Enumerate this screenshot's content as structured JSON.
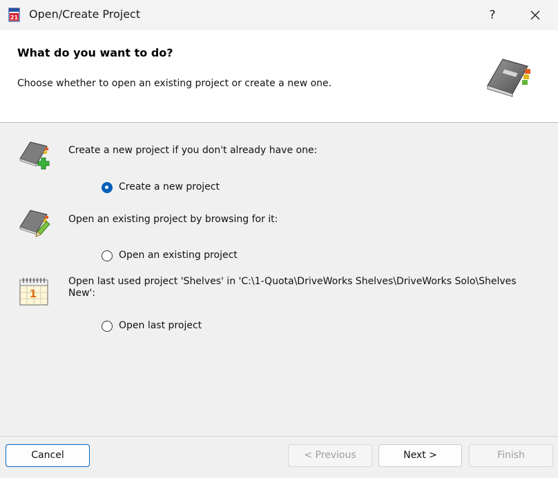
{
  "window": {
    "title": "Open/Create Project",
    "help_label": "?",
    "app_icon_text": "21"
  },
  "header": {
    "title": "What do you want to do?",
    "subtitle": "Choose whether to open an existing project or create a new one."
  },
  "options": [
    {
      "description": "Create a new project if you don't already have one:",
      "radio_label": "Create a new project",
      "selected": true,
      "icon": "book-add-icon"
    },
    {
      "description": "Open an existing project by browsing for it:",
      "radio_label": "Open an existing project",
      "selected": false,
      "icon": "book-edit-icon"
    },
    {
      "description": "Open last used project 'Shelves' in 'C:\\1-Quota\\DriveWorks Shelves\\DriveWorks Solo\\Shelves New':",
      "radio_label": "Open last project",
      "selected": false,
      "icon": "calendar-icon",
      "icon_text": "1"
    }
  ],
  "buttons": {
    "cancel": "Cancel",
    "previous": "< Previous",
    "next": "Next >",
    "finish": "Finish"
  },
  "colors": {
    "accent": "#0067c0",
    "header_bg": "#ffffff",
    "body_bg": "#f0f0f0"
  }
}
